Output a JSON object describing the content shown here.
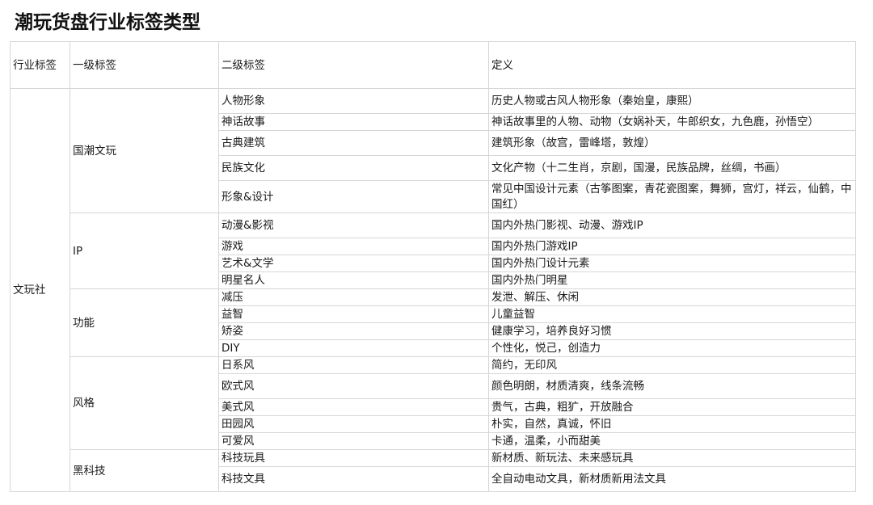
{
  "title": "潮玩货盘行业标签类型",
  "headers": [
    "行业标签",
    "一级标签",
    "二级标签",
    "定义"
  ],
  "industry": "文玩社",
  "groups": [
    {
      "name": "国潮文玩",
      "items": [
        {
          "label": "人物形象",
          "definition": "历史人物或古风人物形象（秦始皇，康熙）"
        },
        {
          "label": "神话故事",
          "definition": "神话故事里的人物、动物（女娲补天，牛郎织女，九色鹿，孙悟空）"
        },
        {
          "label": "古典建筑",
          "definition": "建筑形象（故宫，雷峰塔，敦煌）"
        },
        {
          "label": "民族文化",
          "definition": "文化产物（十二生肖，京剧，国漫，民族品牌，丝绸，书画）"
        },
        {
          "label": "形象&设计",
          "definition": "常见中国设计元素（古筝图案，青花瓷图案，舞狮，宫灯，祥云，仙鹤，中国红）"
        }
      ]
    },
    {
      "name": "IP",
      "items": [
        {
          "label": "动漫&影视",
          "definition": "国内外热门影视、动漫、游戏IP"
        },
        {
          "label": "游戏",
          "definition": "国内外热门游戏IP"
        },
        {
          "label": "艺术&文学",
          "definition": "国内外热门设计元素"
        },
        {
          "label": "明星名人",
          "definition": "国内外热门明星"
        }
      ]
    },
    {
      "name": "功能",
      "items": [
        {
          "label": "减压",
          "definition": "发泄、解压、休闲"
        },
        {
          "label": "益智",
          "definition": "儿童益智"
        },
        {
          "label": "矫姿",
          "definition": "健康学习，培养良好习惯"
        },
        {
          "label": "DIY",
          "definition": "个性化，悦己，创造力"
        }
      ]
    },
    {
      "name": "风格",
      "items": [
        {
          "label": "日系风",
          "definition": "简约，无印风"
        },
        {
          "label": "欧式风",
          "definition": "颜色明朗，材质清爽，线条流畅"
        },
        {
          "label": "美式风",
          "definition": "贵气，古典，粗犷，开放融合"
        },
        {
          "label": "田园风",
          "definition": "朴实，自然，真诚，怀旧"
        },
        {
          "label": "可爱风",
          "definition": "卡通，温柔，小而甜美"
        }
      ]
    },
    {
      "name": "黑科技",
      "items": [
        {
          "label": "科技玩具",
          "definition": "新材质、新玩法、未来感玩具"
        },
        {
          "label": "科技文具",
          "definition": "全自动电动文具，新材质新用法文具"
        }
      ]
    }
  ]
}
